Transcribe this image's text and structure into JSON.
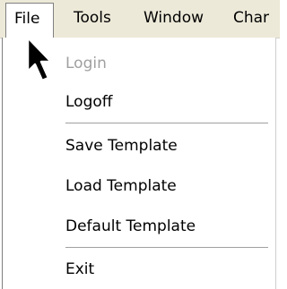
{
  "menubar": {
    "items": [
      {
        "label": "File",
        "active": true
      },
      {
        "label": "Tools"
      },
      {
        "label": "Window"
      },
      {
        "label": "Char"
      }
    ]
  },
  "file_menu": {
    "items": [
      {
        "label": "Login",
        "enabled": false
      },
      {
        "label": "Logoff",
        "enabled": true
      },
      {
        "label": "Save Template",
        "enabled": true
      },
      {
        "label": "Load Template",
        "enabled": true
      },
      {
        "label": "Default Template",
        "enabled": true
      },
      {
        "label": "Exit",
        "enabled": true
      }
    ]
  },
  "cursor": {
    "icon": "arrow-pointer-icon"
  }
}
